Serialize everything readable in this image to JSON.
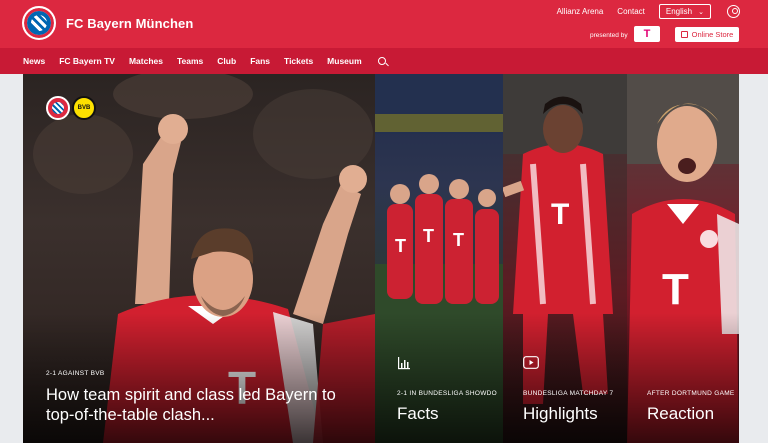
{
  "header": {
    "brand_title": "FC Bayern München",
    "links": [
      "Allianz Arena",
      "Contact"
    ],
    "language": "English",
    "presented_by": "presented by",
    "sponsor_logo": "T",
    "store_label": "Online Store"
  },
  "nav": {
    "items": [
      "News",
      "FC Bayern TV",
      "Matches",
      "Teams",
      "Club",
      "Fans",
      "Tickets",
      "Museum"
    ]
  },
  "hero": {
    "badge_right": "BVB",
    "main": {
      "tag": "2-1 AGAINST BVB",
      "headline": "How team spirit and class led Bayern to top-of-the-table clash..."
    },
    "panels": [
      {
        "tag": "2-1 IN BUNDESLIGA SHOWDO",
        "title": "Facts",
        "icon": "bar-chart-icon"
      },
      {
        "tag": "BUNDESLIGA MATCHDAY 7",
        "title": "Highlights",
        "icon": "play-icon"
      },
      {
        "tag": "AFTER DORTMUND GAME",
        "title": "Reaction",
        "icon": ""
      }
    ]
  },
  "colors": {
    "header_red": "#dc2840",
    "nav_red": "#c81a35",
    "sponsor_magenta": "#e20074",
    "kit_red": "#d2202f"
  }
}
